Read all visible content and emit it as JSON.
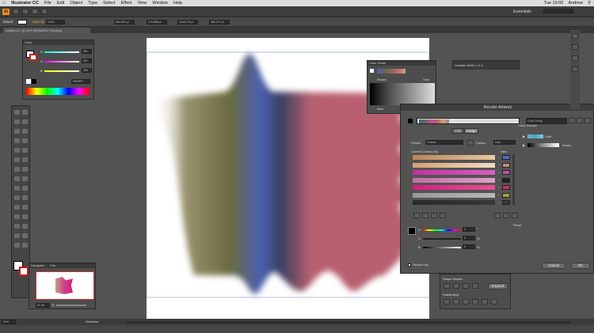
{
  "menubar": {
    "app_name": "Illustrator CC",
    "items": [
      "File",
      "Edit",
      "Object",
      "Type",
      "Select",
      "Effect",
      "View",
      "Window",
      "Help"
    ],
    "clock": "Tue 19:00",
    "user": "Andrew"
  },
  "appbar": {
    "workspace": "Essentials"
  },
  "control_bar": {
    "selection": "Mixed",
    "opacity_label": "Opacity",
    "opacity_value": "100%",
    "x": "502.892 pt",
    "y": "275.888 pt",
    "w": "1128.175 pt",
    "h": "380.371 pt"
  },
  "document_tab": {
    "title": "Untitled-17 @ 61% (RGB/GPU Preview)"
  },
  "color_panel": {
    "title": "Color",
    "labels": [
      "R",
      "G",
      "B"
    ],
    "values": [
      "251",
      "251",
      "255"
    ],
    "hex_value": "FBFBFF"
  },
  "color_guide": {
    "title": "Color Guide",
    "footer_left": "Shades",
    "footer_right": "Tints",
    "none_label": "None"
  },
  "variable_panel": {
    "title": "Variable Width 1.4.4"
  },
  "recolor": {
    "title": "Recolor Artwork",
    "group_name": "Color Group",
    "tab_edit": "Edit",
    "tab_assign": "Assign",
    "preset_label": "Preset:",
    "preset_value": "Custom",
    "colors_label": "Colors:",
    "colors_value": "Auto",
    "current_colors": "Current Colors (10)",
    "new_label": "New",
    "color_groups_label": "Color Groups",
    "groups": [
      "Cold",
      "Grass"
    ],
    "slider_labels": [
      "H",
      "S",
      "B"
    ],
    "slider_values": [
      "0",
      "0",
      "0"
    ],
    "pct": [
      "%",
      "%",
      "%"
    ],
    "deg": "°",
    "recolor_checkbox_label": "Recolor Art",
    "cancel_label": "Cancel",
    "ok_label": "OK",
    "preset_side_label": "Prese",
    "current_rows": [
      {
        "from": "#b8855a",
        "to": "#e8c8a0",
        "arrow": "→",
        "sw": "#5568c0"
      },
      {
        "from": "#d8a070",
        "to": "#f0dcc0",
        "arrow": "→",
        "sw": "#c09070"
      },
      {
        "from": "#c030a0",
        "to": "#d860c0",
        "arrow": "→",
        "sw": "#c050a0"
      },
      {
        "from": "#c070a0",
        "to": "#e0a0c8",
        "arrow": "→",
        "sw": "#202020"
      },
      {
        "from": "#d02080",
        "to": "#e85090",
        "arrow": "→",
        "sw": "#c83060"
      },
      {
        "from": "#989898",
        "to": "#b8b8b8",
        "arrow": "→",
        "sw": "#a0a040"
      },
      {
        "from": "#2a2a2a",
        "to": "#383838",
        "arrow": "→",
        "sw": "#3a3a3a"
      }
    ]
  },
  "navigator": {
    "tab_navigator": "Navigator",
    "tab_info": "Info",
    "zoom": "61.06",
    "pct": "%"
  },
  "pathfinder": {
    "shape_modes": "Shape Modes:",
    "pathfinders": "Pathfinders:",
    "expand": "Expand"
  },
  "status": {
    "zoom": "61%",
    "mode": "Selection"
  },
  "colors": {
    "accent": "#4a6ab8"
  }
}
